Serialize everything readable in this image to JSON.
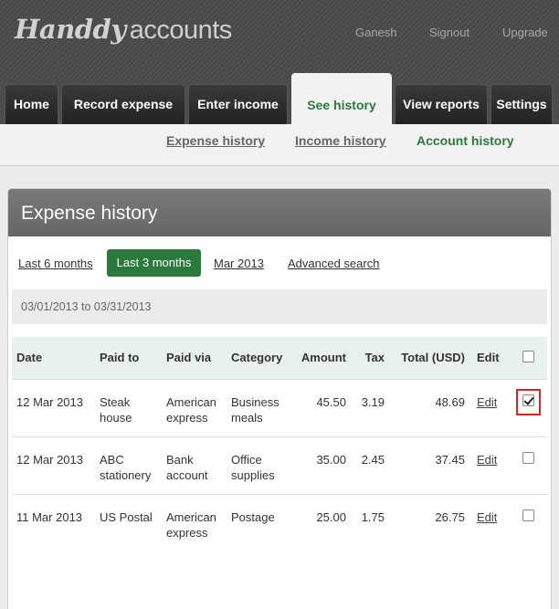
{
  "app": {
    "logo_script": "Handdy",
    "logo_text": "accounts",
    "top_links": [
      "Ganesh",
      "Signout",
      "Upgrade"
    ]
  },
  "tabs": [
    {
      "label": "Home",
      "active": false
    },
    {
      "label": "Record expense",
      "active": false
    },
    {
      "label": "Enter income",
      "active": false
    },
    {
      "label": "See history",
      "active": true
    },
    {
      "label": "View reports",
      "active": false
    },
    {
      "label": "Settings",
      "active": false
    }
  ],
  "subnav": [
    {
      "label": "Expense history",
      "active": false
    },
    {
      "label": "Income history",
      "active": false
    },
    {
      "label": "Account history",
      "active": true
    }
  ],
  "panel": {
    "title": "Expense history",
    "filters": {
      "last6": "Last 6 months",
      "last3": "Last 3 months",
      "month": "Mar 2013",
      "advanced": "Advanced search"
    },
    "range": "03/01/2013 to 03/31/2013"
  },
  "table": {
    "headers": [
      "Date",
      "Paid to",
      "Paid via",
      "Category",
      "Amount",
      "Tax",
      "Total (USD)",
      "Edit"
    ],
    "rows": [
      {
        "date": "12 Mar 2013",
        "paid_to": [
          "Steak",
          "house"
        ],
        "paid_via": [
          "American",
          "express"
        ],
        "category": [
          "Business",
          "meals"
        ],
        "amount": "45.50",
        "tax": "3.19",
        "total": "48.69",
        "edit": "Edit",
        "checked": true
      },
      {
        "date": "12 Mar 2013",
        "paid_to": [
          "ABC",
          "stationery"
        ],
        "paid_via": [
          "Bank",
          "account"
        ],
        "category": [
          "Office",
          "supplies"
        ],
        "amount": "35.00",
        "tax": "2.45",
        "total": "37.45",
        "edit": "Edit",
        "checked": false
      },
      {
        "date": "11 Mar 2013",
        "paid_to": [
          "US Postal"
        ],
        "paid_via": [
          "American",
          "express"
        ],
        "category": [
          "Postage"
        ],
        "amount": "25.00",
        "tax": "1.75",
        "total": "26.75",
        "edit": "Edit",
        "checked": false
      }
    ]
  },
  "colors": {
    "accent_green": "#2c7a3b",
    "header_dark": "#4a4a4a",
    "panel_head": "#707070",
    "highlight_red": "#dd2222"
  }
}
